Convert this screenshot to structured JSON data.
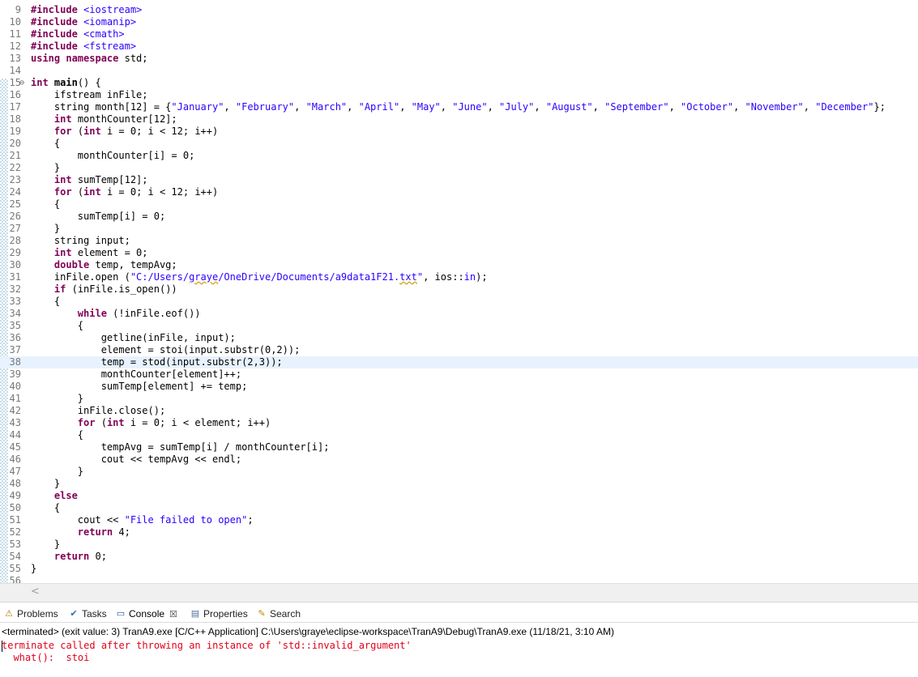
{
  "editor": {
    "lines": [
      {
        "n": "9",
        "segs": [
          {
            "t": "#include ",
            "c": "kw"
          },
          {
            "t": "<iostream>",
            "c": "str"
          }
        ]
      },
      {
        "n": "10",
        "segs": [
          {
            "t": "#include ",
            "c": "kw"
          },
          {
            "t": "<iomanip>",
            "c": "str"
          }
        ]
      },
      {
        "n": "11",
        "segs": [
          {
            "t": "#include ",
            "c": "kw"
          },
          {
            "t": "<cmath>",
            "c": "str"
          }
        ]
      },
      {
        "n": "12",
        "segs": [
          {
            "t": "#include ",
            "c": "kw"
          },
          {
            "t": "<fstream>",
            "c": "str"
          }
        ]
      },
      {
        "n": "13",
        "segs": [
          {
            "t": "using namespace ",
            "c": "kw"
          },
          {
            "t": "std;",
            "c": ""
          }
        ]
      },
      {
        "n": "14",
        "segs": []
      },
      {
        "n": "15",
        "fold": "⊖",
        "segs": [
          {
            "t": "int ",
            "c": "kw"
          },
          {
            "t": "main",
            "c": "bold"
          },
          {
            "t": "() {",
            "c": ""
          }
        ]
      },
      {
        "n": "16",
        "segs": [
          {
            "t": "    ifstream inFile;",
            "c": ""
          }
        ]
      },
      {
        "n": "17",
        "segs": [
          {
            "t": "    string month[12] = {",
            "c": ""
          },
          {
            "t": "\"January\"",
            "c": "str"
          },
          {
            "t": ", ",
            "c": ""
          },
          {
            "t": "\"February\"",
            "c": "str"
          },
          {
            "t": ", ",
            "c": ""
          },
          {
            "t": "\"March\"",
            "c": "str"
          },
          {
            "t": ", ",
            "c": ""
          },
          {
            "t": "\"April\"",
            "c": "str"
          },
          {
            "t": ", ",
            "c": ""
          },
          {
            "t": "\"May\"",
            "c": "str"
          },
          {
            "t": ", ",
            "c": ""
          },
          {
            "t": "\"June\"",
            "c": "str"
          },
          {
            "t": ", ",
            "c": ""
          },
          {
            "t": "\"July\"",
            "c": "str"
          },
          {
            "t": ", ",
            "c": ""
          },
          {
            "t": "\"August\"",
            "c": "str"
          },
          {
            "t": ", ",
            "c": ""
          },
          {
            "t": "\"September\"",
            "c": "str"
          },
          {
            "t": ", ",
            "c": ""
          },
          {
            "t": "\"October\"",
            "c": "str"
          },
          {
            "t": ", ",
            "c": ""
          },
          {
            "t": "\"November\"",
            "c": "str"
          },
          {
            "t": ", ",
            "c": ""
          },
          {
            "t": "\"December\"",
            "c": "str"
          },
          {
            "t": "};",
            "c": ""
          }
        ]
      },
      {
        "n": "18",
        "segs": [
          {
            "t": "    ",
            "c": ""
          },
          {
            "t": "int ",
            "c": "kw"
          },
          {
            "t": "monthCounter[12];",
            "c": ""
          }
        ]
      },
      {
        "n": "19",
        "segs": [
          {
            "t": "    ",
            "c": ""
          },
          {
            "t": "for ",
            "c": "kw"
          },
          {
            "t": "(",
            "c": ""
          },
          {
            "t": "int ",
            "c": "kw"
          },
          {
            "t": "i = 0; i < 12; i++)",
            "c": ""
          }
        ]
      },
      {
        "n": "20",
        "segs": [
          {
            "t": "    {",
            "c": ""
          }
        ]
      },
      {
        "n": "21",
        "segs": [
          {
            "t": "        monthCounter[i] = 0;",
            "c": ""
          }
        ]
      },
      {
        "n": "22",
        "segs": [
          {
            "t": "    }",
            "c": ""
          }
        ]
      },
      {
        "n": "23",
        "segs": [
          {
            "t": "    ",
            "c": ""
          },
          {
            "t": "int ",
            "c": "kw"
          },
          {
            "t": "sumTemp[12];",
            "c": ""
          }
        ]
      },
      {
        "n": "24",
        "segs": [
          {
            "t": "    ",
            "c": ""
          },
          {
            "t": "for ",
            "c": "kw"
          },
          {
            "t": "(",
            "c": ""
          },
          {
            "t": "int ",
            "c": "kw"
          },
          {
            "t": "i = 0; i < 12; i++)",
            "c": ""
          }
        ]
      },
      {
        "n": "25",
        "segs": [
          {
            "t": "    {",
            "c": ""
          }
        ]
      },
      {
        "n": "26",
        "segs": [
          {
            "t": "        sumTemp[i] = 0;",
            "c": ""
          }
        ]
      },
      {
        "n": "27",
        "segs": [
          {
            "t": "    }",
            "c": ""
          }
        ]
      },
      {
        "n": "28",
        "segs": [
          {
            "t": "    string input;",
            "c": ""
          }
        ]
      },
      {
        "n": "29",
        "segs": [
          {
            "t": "    ",
            "c": ""
          },
          {
            "t": "int ",
            "c": "kw"
          },
          {
            "t": "element = 0;",
            "c": ""
          }
        ]
      },
      {
        "n": "30",
        "segs": [
          {
            "t": "    ",
            "c": ""
          },
          {
            "t": "double ",
            "c": "kw"
          },
          {
            "t": "temp, tempAvg;",
            "c": ""
          }
        ]
      },
      {
        "n": "31",
        "segs": [
          {
            "t": "    inFile.open (",
            "c": ""
          },
          {
            "t": "\"C:/Users/",
            "c": "str"
          },
          {
            "t": "graye",
            "c": "str typo"
          },
          {
            "t": "/OneDrive/Documents/a9data1F21.",
            "c": "str"
          },
          {
            "t": "txt",
            "c": "str typo"
          },
          {
            "t": "\"",
            "c": "str"
          },
          {
            "t": ", ios::",
            "c": ""
          },
          {
            "t": "in",
            "c": "str"
          },
          {
            "t": ");",
            "c": ""
          }
        ]
      },
      {
        "n": "32",
        "segs": [
          {
            "t": "    ",
            "c": ""
          },
          {
            "t": "if ",
            "c": "kw"
          },
          {
            "t": "(inFile.is_open())",
            "c": ""
          }
        ]
      },
      {
        "n": "33",
        "segs": [
          {
            "t": "    {",
            "c": ""
          }
        ]
      },
      {
        "n": "34",
        "segs": [
          {
            "t": "        ",
            "c": ""
          },
          {
            "t": "while ",
            "c": "kw"
          },
          {
            "t": "(!inFile.eof())",
            "c": ""
          }
        ]
      },
      {
        "n": "35",
        "segs": [
          {
            "t": "        {",
            "c": ""
          }
        ]
      },
      {
        "n": "36",
        "segs": [
          {
            "t": "            getline(inFile, input);",
            "c": ""
          }
        ]
      },
      {
        "n": "37",
        "segs": [
          {
            "t": "            element = stoi(input.substr(0,2));",
            "c": ""
          }
        ]
      },
      {
        "n": "38",
        "current": true,
        "segs": [
          {
            "t": "            temp = stod(input.substr(2,3));",
            "c": ""
          }
        ]
      },
      {
        "n": "39",
        "segs": [
          {
            "t": "            monthCounter[element]++;",
            "c": ""
          }
        ]
      },
      {
        "n": "40",
        "segs": [
          {
            "t": "            sumTemp[element] += temp;",
            "c": ""
          }
        ]
      },
      {
        "n": "41",
        "segs": [
          {
            "t": "        }",
            "c": ""
          }
        ]
      },
      {
        "n": "42",
        "segs": [
          {
            "t": "        inFile.close();",
            "c": ""
          }
        ]
      },
      {
        "n": "43",
        "segs": [
          {
            "t": "        ",
            "c": ""
          },
          {
            "t": "for ",
            "c": "kw"
          },
          {
            "t": "(",
            "c": ""
          },
          {
            "t": "int ",
            "c": "kw"
          },
          {
            "t": "i = 0; i < element; i++)",
            "c": ""
          }
        ]
      },
      {
        "n": "44",
        "segs": [
          {
            "t": "        {",
            "c": ""
          }
        ]
      },
      {
        "n": "45",
        "segs": [
          {
            "t": "            tempAvg = sumTemp[i] / monthCounter[i];",
            "c": ""
          }
        ]
      },
      {
        "n": "46",
        "segs": [
          {
            "t": "            cout << tempAvg << endl;",
            "c": ""
          }
        ]
      },
      {
        "n": "47",
        "segs": [
          {
            "t": "        }",
            "c": ""
          }
        ]
      },
      {
        "n": "48",
        "segs": [
          {
            "t": "    }",
            "c": ""
          }
        ]
      },
      {
        "n": "49",
        "segs": [
          {
            "t": "    ",
            "c": ""
          },
          {
            "t": "else",
            "c": "kw"
          }
        ]
      },
      {
        "n": "50",
        "segs": [
          {
            "t": "    {",
            "c": ""
          }
        ]
      },
      {
        "n": "51",
        "segs": [
          {
            "t": "        cout << ",
            "c": ""
          },
          {
            "t": "\"File failed to open\"",
            "c": "str"
          },
          {
            "t": ";",
            "c": ""
          }
        ]
      },
      {
        "n": "52",
        "segs": [
          {
            "t": "        ",
            "c": ""
          },
          {
            "t": "return ",
            "c": "kw"
          },
          {
            "t": "4;",
            "c": ""
          }
        ]
      },
      {
        "n": "53",
        "segs": [
          {
            "t": "    }",
            "c": ""
          }
        ]
      },
      {
        "n": "54",
        "segs": [
          {
            "t": "    ",
            "c": ""
          },
          {
            "t": "return ",
            "c": "kw"
          },
          {
            "t": "0;",
            "c": ""
          }
        ]
      },
      {
        "n": "55",
        "segs": [
          {
            "t": "}",
            "c": ""
          }
        ]
      },
      {
        "n": "56",
        "segs": []
      }
    ]
  },
  "scrollbar": {
    "left_arrow": "<"
  },
  "tabs": [
    {
      "id": "problems",
      "label": "Problems",
      "icon": "problems-icon",
      "glyph": "⚠"
    },
    {
      "id": "tasks",
      "label": "Tasks",
      "icon": "tasks-icon",
      "glyph": "✔"
    },
    {
      "id": "console",
      "label": "Console",
      "icon": "console-icon",
      "glyph": "▭",
      "close": "☒"
    },
    {
      "id": "properties",
      "label": "Properties",
      "icon": "properties-icon",
      "glyph": "▤"
    },
    {
      "id": "search",
      "label": "Search",
      "icon": "search-icon",
      "glyph": "✎"
    }
  ],
  "console": {
    "status": "<terminated> (exit value: 3) TranA9.exe [C/C++ Application] C:\\Users\\graye\\eclipse-workspace\\TranA9\\Debug\\TranA9.exe (11/18/21, 3:10 AM)",
    "output": [
      "terminate called after throwing an instance of 'std::invalid_argument'",
      "  what():  stoi"
    ]
  },
  "colors": {
    "keyword": "#7f0055",
    "string": "#2a00ff",
    "error": "#e2001a",
    "current_line": "#e8f2fe"
  }
}
